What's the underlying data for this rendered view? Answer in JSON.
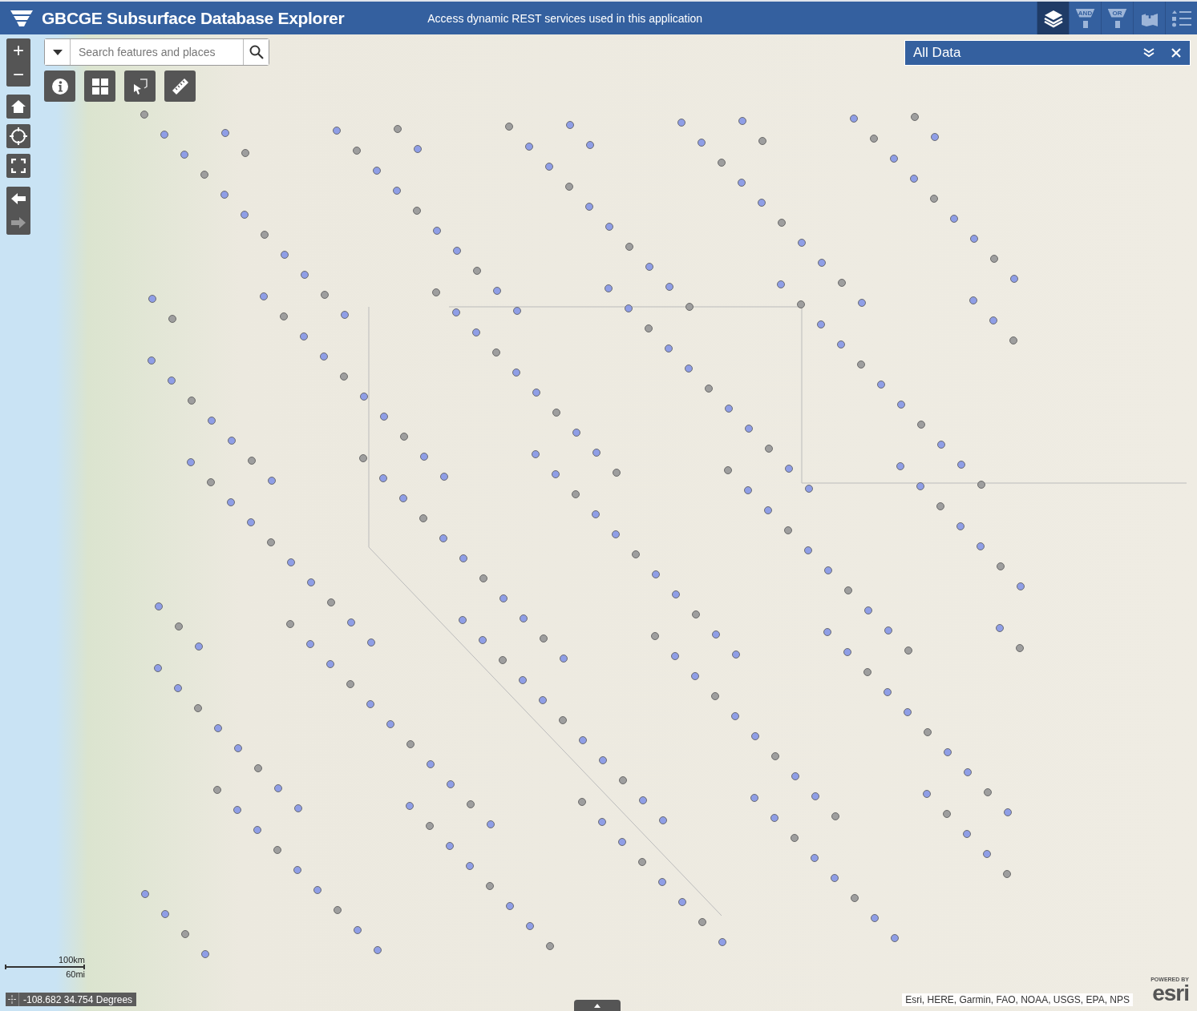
{
  "header": {
    "title": "GBCGE Subsurface Database Explorer",
    "link": "Access dynamic REST services used in this application",
    "tools": [
      {
        "kind": "layers",
        "selected": true
      },
      {
        "kind": "filter",
        "label": "AND",
        "selected": false
      },
      {
        "kind": "filter",
        "label": "OR",
        "selected": false
      },
      {
        "kind": "add-map",
        "selected": false
      },
      {
        "kind": "legend",
        "selected": false
      }
    ]
  },
  "zoom": [
    {
      "label": "+"
    },
    {
      "label": "−"
    }
  ],
  "navigation": [
    {
      "kind": "home"
    },
    {
      "kind": "locate"
    },
    {
      "kind": "fullscreen"
    }
  ],
  "history": [
    {
      "kind": "back",
      "disabled": false
    },
    {
      "kind": "forward",
      "disabled": true
    }
  ],
  "search": {
    "placeholder": "Search features and places"
  },
  "map_tools": [
    {
      "kind": "info"
    },
    {
      "kind": "grid"
    },
    {
      "kind": "select"
    },
    {
      "kind": "measure"
    }
  ],
  "panel": {
    "title": "All Data"
  },
  "scale": {
    "metric": "100km",
    "imperial": "60mi"
  },
  "coordinates": {
    "value": "-108.682 34.754 Degrees"
  },
  "attribution": "Esri, HERE, Garmin, FAO, NOAA, USGS, EPA, NPS",
  "logo": {
    "caption": "POWERED BY",
    "name": "esri"
  }
}
